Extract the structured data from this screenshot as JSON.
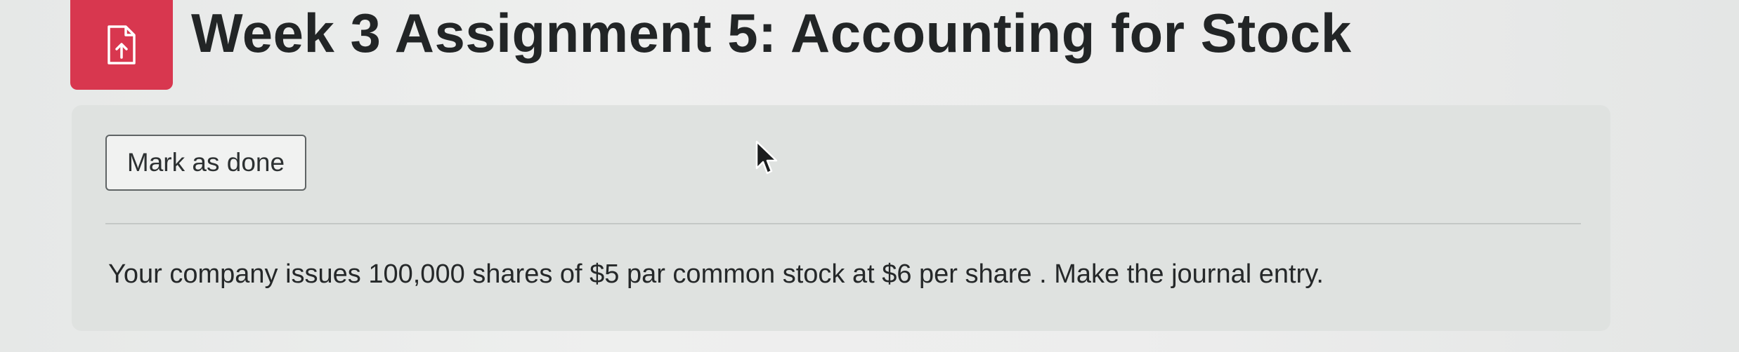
{
  "assignment": {
    "title": "Week 3 Assignment 5: Accounting for Stock",
    "icon": "assignment-upload-icon"
  },
  "activity": {
    "mark_done_label": "Mark as done",
    "description": "Your company issues 100,000 shares of $5 par common stock at $6 per share . Make the journal entry."
  },
  "colors": {
    "icon_tile": "#d8374f",
    "title_text": "#222526",
    "card_background": "#dfe2e0",
    "button_border": "#5f6465"
  }
}
